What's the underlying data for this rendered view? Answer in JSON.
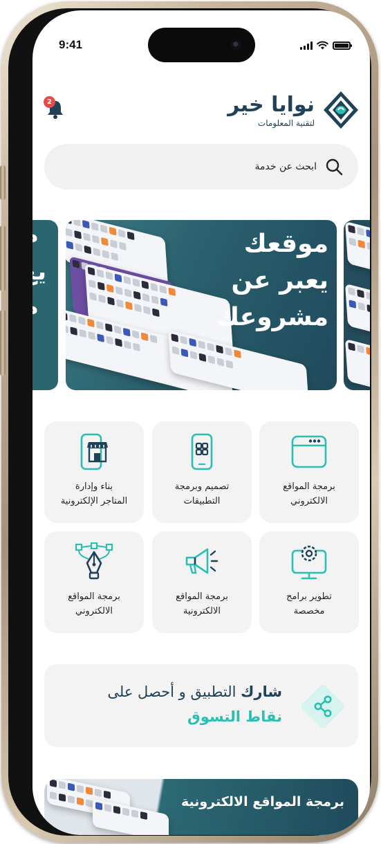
{
  "status_bar": {
    "time": "9:41"
  },
  "header": {
    "notification_count": "2",
    "brand_name": "نوايا خير",
    "brand_subtitle": "لتقنية المعلومات",
    "logo_icon": "diamond-wave-logo",
    "bell_icon": "bell-icon"
  },
  "search": {
    "placeholder": "ابحث عن خدمة",
    "icon": "search-icon"
  },
  "hero": {
    "line1": "موقعك",
    "line2": "يعبر عن",
    "line3": "مشروعك",
    "peek_prev": [
      "م",
      "يع",
      "م"
    ]
  },
  "services": [
    {
      "label_line1": "برمجة المواقع",
      "label_line2": "الالكتروني",
      "icon": "browser-window-icon"
    },
    {
      "label_line1": "تصميم وبرمجة",
      "label_line2": "التطبيقات",
      "icon": "mobile-apps-icon"
    },
    {
      "label_line1": "بناء وإدارة",
      "label_line2": "المتاجر الإلكترونية",
      "icon": "mobile-store-icon"
    },
    {
      "label_line1": "تطوير برامج",
      "label_line2": "مخصصة",
      "icon": "monitor-gear-icon"
    },
    {
      "label_line1": "برمجة المواقع",
      "label_line2": "الالكترونية",
      "icon": "megaphone-icon"
    },
    {
      "label_line1": "برمجة المواقع",
      "label_line2": "الالكتروني",
      "icon": "pen-tool-icon"
    }
  ],
  "share_banner": {
    "bold": "شارك",
    "rest": " التطبيق و أحصل على",
    "highlight": "نقاط التسوق",
    "icon": "share-icon"
  },
  "bottom_banner": {
    "title": "برمجة المواقع الالكترونية"
  },
  "colors": {
    "navy": "#1f4258",
    "teal": "#2bbfb2",
    "badge": "#e84a4a",
    "card": "#f3f3f3"
  }
}
